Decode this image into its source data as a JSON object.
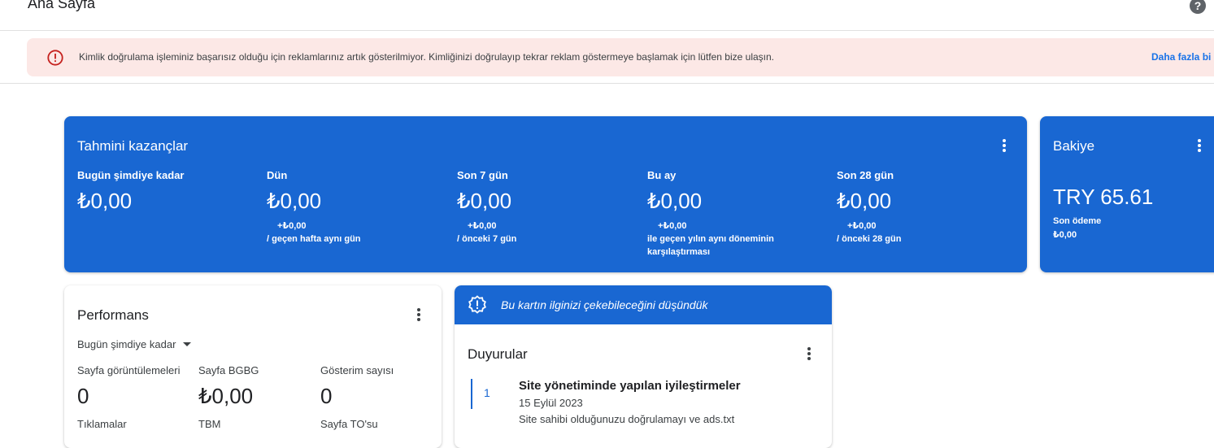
{
  "header": {
    "title": "Ana Sayfa",
    "help_icon": "help-circle-icon",
    "help_symbol": "?"
  },
  "alert": {
    "icon": "error-circle-icon",
    "message": "Kimlik doğrulama işleminiz başarısız olduğu için reklamlarınız artık gösterilmiyor. Kimliğinizi doğrulayıp tekrar reklam göstermeye başlamak için lütfen bize ulaşın.",
    "link_label": "Daha fazla bi",
    "color": "#fce8e6"
  },
  "earnings": {
    "title": "Tahmini kazançlar",
    "metrics": [
      {
        "label": "Bugün şimdiye kadar",
        "value": "₺0,00",
        "delta": "",
        "compare": ""
      },
      {
        "label": "Dün",
        "value": "₺0,00",
        "delta": "+₺0,00",
        "compare": "/ geçen hafta aynı gün"
      },
      {
        "label": "Son 7 gün",
        "value": "₺0,00",
        "delta": "+₺0,00",
        "compare": "/ önceki 7 gün"
      },
      {
        "label": "Bu ay",
        "value": "₺0,00",
        "delta": "+₺0,00",
        "compare": "ile geçen yılın aynı döneminin karşılaştırması"
      },
      {
        "label": "Son 28 gün",
        "value": "₺0,00",
        "delta": "+₺0,00",
        "compare": "/ önceki 28 gün"
      }
    ],
    "color": "#1967d2"
  },
  "balance": {
    "title": "Bakiye",
    "value": "TRY 65.61",
    "last_payment_label": "Son ödeme",
    "last_payment_value": "₺0,00"
  },
  "performance": {
    "title": "Performans",
    "range": "Bugün şimdiye kadar",
    "metrics": [
      {
        "label": "Sayfa görüntülemeleri",
        "value": "0"
      },
      {
        "label": "Sayfa BGBG",
        "value": "₺0,00"
      },
      {
        "label": "Gösterim sayısı",
        "value": "0"
      }
    ],
    "more_metrics": [
      "Tıklamalar",
      "TBM",
      "Sayfa TO'su"
    ]
  },
  "suggestion": {
    "icon": "insight-badge-icon",
    "text": "Bu kartın ilginizi çekebileceğini düşündük"
  },
  "announcements": {
    "title": "Duyurular",
    "items": [
      {
        "number": "1",
        "title": "Site yönetiminde yapılan iyileştirmeler",
        "date": "15 Eylül 2023",
        "description": "Site sahibi olduğunuzu doğrulamayı ve ads.txt"
      }
    ]
  }
}
